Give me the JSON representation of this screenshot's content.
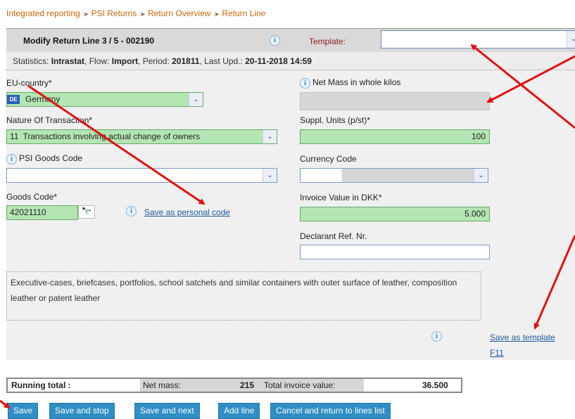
{
  "breadcrumb": {
    "items": [
      "Integrated reporting",
      "PSI Returns",
      "Return Overview",
      "Return Line"
    ],
    "separator": ":▸"
  },
  "header": {
    "title": "Modify Return Line 3 / 5 - 002190",
    "template_label": "Template:",
    "template_value": ""
  },
  "stats": {
    "statistics_label": "Statistics:",
    "statistics_value": "Intrastat",
    "flow_label": ", Flow:",
    "flow_value": "Import",
    "period_label": ", Period:",
    "period_value": "201811",
    "last_upd_label": ", Last Upd.:",
    "last_upd_value": "20-11-2018 14:59"
  },
  "form": {
    "eu_country_label": "EU-country*",
    "eu_country_flag": "DE",
    "eu_country_value": "Germany",
    "nature_label": "Nature Of Transaction*",
    "nature_code": "11",
    "nature_value": "Transactions involving actual change of owners",
    "psi_goods_label": "PSI Goods Code",
    "psi_goods_value": "",
    "goods_code_label": "Goods Code*",
    "goods_code_value": "42021110",
    "save_personal_code": "Save as personal code",
    "net_mass_label": "Net Mass in whole kilos",
    "net_mass_value": "",
    "suppl_units_label": "Suppl. Units (p/st)*",
    "suppl_units_value": "100",
    "currency_label": "Currency Code",
    "currency_value": "",
    "invoice_label": "Invoice Value in DKK*",
    "invoice_value": "5.000",
    "declarant_label": "Declarant Ref. Nr.",
    "declarant_value": "",
    "description": "Executive-cases, briefcases, portfolios, school satchels and similar containers with outer surface of leather, composition leather or patent leather",
    "save_template": "Save as template",
    "shortcut": "F11"
  },
  "running_total": {
    "label": "Running total :",
    "net_mass_label": "Net mass:",
    "net_mass_value": "215",
    "invoice_label": "Total invoice value:",
    "invoice_value": "36.500"
  },
  "buttons": {
    "save": "Save",
    "save_stop": "Save and stop",
    "save_next": "Save and next",
    "add_line": "Add line",
    "cancel": "Cancel and return to lines list"
  },
  "icons": {
    "info": "i",
    "dropdown": "⌄",
    "binoculars": "🔭"
  },
  "colors": {
    "required_field": "#b3e6b3",
    "button": "#2f8fc4",
    "breadcrumb": "#c8640a",
    "annotation_arrow": "#e01010"
  }
}
